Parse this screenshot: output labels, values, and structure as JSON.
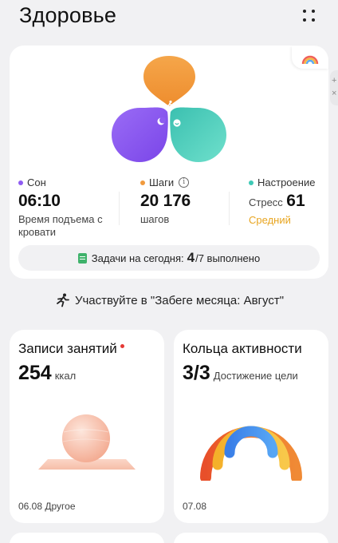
{
  "header": {
    "title": "Здоровье",
    "menu_icon": "grid-dots-icon"
  },
  "summary": {
    "sleep": {
      "label": "Сон",
      "value": "06:10",
      "sub": "Время подъема с кровати",
      "color": "#8f5cf2"
    },
    "steps": {
      "label": "Шаги",
      "value": "20 176",
      "sub": "шагов",
      "color": "#f09a3e"
    },
    "mood": {
      "label": "Настроение",
      "stress_label": "Стресс",
      "stress_value": "61",
      "level": "Средний",
      "color": "#3ec9b6"
    },
    "tasks": {
      "prefix": "Задачи на сегодня:",
      "done": "4",
      "rest": "/7 выполнено"
    }
  },
  "challenge": {
    "text": "Участвуйте в \"Забеге месяца: Август\""
  },
  "activity": {
    "title": "Записи занятий",
    "value": "254",
    "unit": "ккал",
    "footer": "06.08 Другое"
  },
  "rings": {
    "title": "Кольца активности",
    "value": "3/3",
    "caption": "Достижение цели",
    "footer": "07.08"
  }
}
